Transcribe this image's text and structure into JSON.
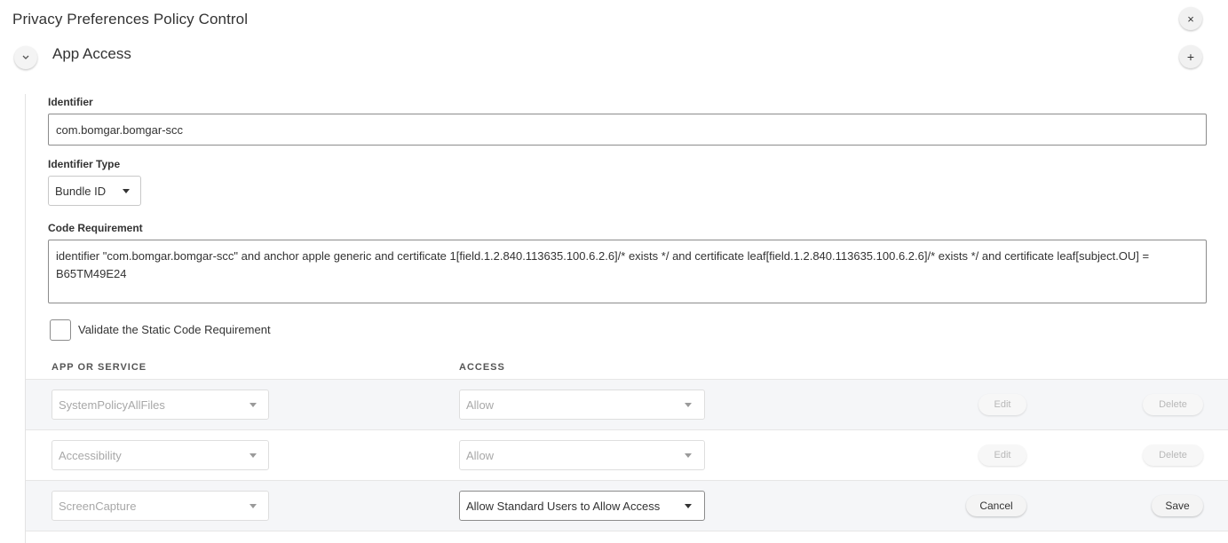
{
  "header": {
    "title": "Privacy Preferences Policy Control",
    "close_icon": "×"
  },
  "section": {
    "title": "App Access",
    "collapse_icon": "⌄",
    "add_icon": "+"
  },
  "form": {
    "identifier_label": "Identifier",
    "identifier_value": "com.bomgar.bomgar-scc",
    "identifier_type_label": "Identifier Type",
    "identifier_type_value": "Bundle ID",
    "code_requirement_label": "Code Requirement",
    "code_requirement_value": "identifier \"com.bomgar.bomgar-scc\" and anchor apple generic and certificate 1[field.1.2.840.113635.100.6.2.6]/* exists */ and certificate leaf[field.1.2.840.113635.100.6.2.6]/* exists */ and certificate leaf[subject.OU] = B65TM49E24",
    "validate_label": "Validate the Static Code Requirement",
    "validate_checked": false
  },
  "table": {
    "col_app": "APP OR SERVICE",
    "col_access": "ACCESS",
    "rows": [
      {
        "service": "SystemPolicyAllFiles",
        "access": "Allow",
        "btn1": "Edit",
        "btn2": "Delete"
      },
      {
        "service": "Accessibility",
        "access": "Allow",
        "btn1": "Edit",
        "btn2": "Delete"
      },
      {
        "service": "ScreenCapture",
        "access": "Allow Standard Users to Allow Access",
        "btn1": "Cancel",
        "btn2": "Save"
      }
    ]
  }
}
